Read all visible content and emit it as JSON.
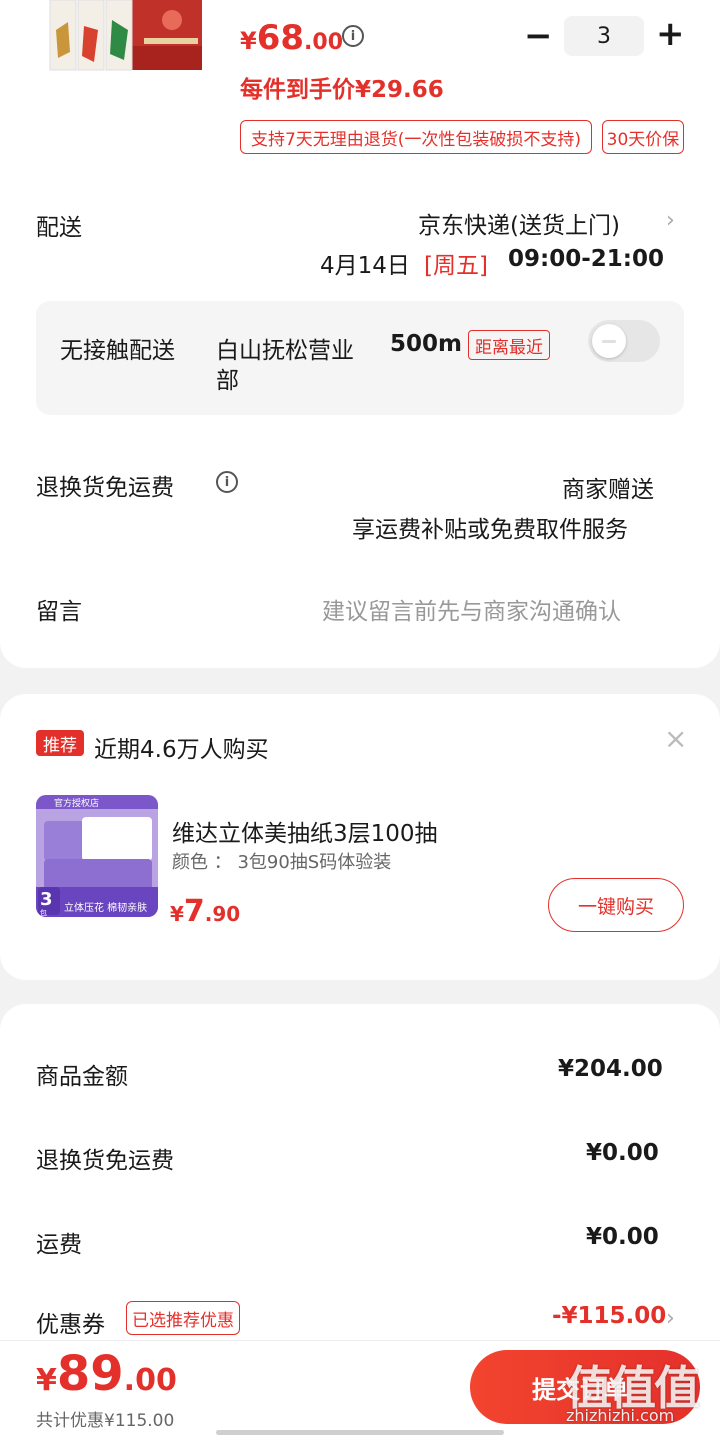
{
  "product": {
    "price_currency": "¥",
    "price_integer": "68",
    "price_decimal": ".00",
    "info_symbol": "i",
    "unit_price": "每件到手价¥29.66",
    "quantity": "3",
    "minus_symbol": "−",
    "plus_symbol": "+",
    "tags": [
      "支持7天无理由退货(一次性包装破损不支持)",
      "30天价保"
    ]
  },
  "delivery": {
    "label": "配送",
    "carrier": "京东快递(送货上门)",
    "date": "4月14日",
    "weekday": "[周五]",
    "time_window": "09:00-21:00",
    "contactless_label": "无接触配送",
    "station_name_line1": "白山抚松营业",
    "station_name_line2": "部",
    "distance": "500m",
    "nearest_tag": "距离最近",
    "contactless_enabled": false
  },
  "return_shipping": {
    "label": "退换货免运费",
    "value": "商家赠送",
    "desc": "享运费补贴或免费取件服务"
  },
  "message": {
    "label": "留言",
    "placeholder": "建议留言前先与商家沟通确认"
  },
  "recommend": {
    "badge": "推荐",
    "title": "近期4.6万人购买",
    "close_symbol": "×",
    "item_name": "维达立体美抽纸3层100抽",
    "item_spec": "颜色 ： 3包90抽S码体验装",
    "item_price_currency": "¥",
    "item_price_integer": "7",
    "item_price_decimal": ".90",
    "buy_button": "一键购买",
    "img_text": {
      "top_label": "官方授权店",
      "count": "3",
      "count_unit": "包",
      "banner": "立体压花  棉韧亲肤"
    }
  },
  "amounts": {
    "goods_label": "商品金额",
    "goods_value": "¥204.00",
    "return_label": "退换货免运费",
    "return_value": "¥0.00",
    "shipping_label": "运费",
    "shipping_value": "¥0.00",
    "coupon_label": "优惠券",
    "coupon_tag": "已选推荐优惠",
    "coupon_value": "-¥115.00"
  },
  "bottom": {
    "total_currency": "¥",
    "total_integer": "89",
    "total_decimal": ".00",
    "discount_text": "共计优惠¥115.00",
    "submit_label": "提交订单",
    "watermark": "值值值",
    "watermark_url": "zhizhizhi.com"
  },
  "colors": {
    "accent": "#e4302b",
    "background": "#f2f2f2",
    "card": "#ffffff"
  }
}
